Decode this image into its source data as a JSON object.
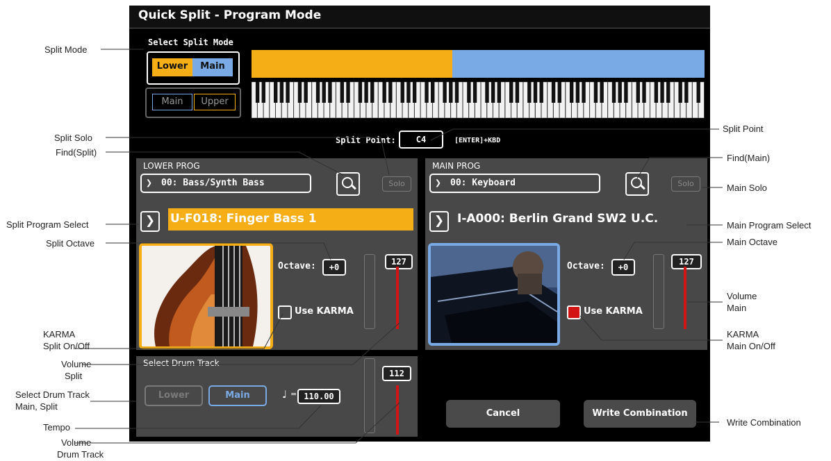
{
  "title": "Quick Split  - Program Mode",
  "split_mode": {
    "heading": "Select Split Mode",
    "option1": {
      "left": "Lower",
      "right": "Main"
    },
    "option2": {
      "left": "Main",
      "right": "Upper"
    }
  },
  "split_point": {
    "label": "Split Point:",
    "value": "C4",
    "hint": "[ENTER]+KBD"
  },
  "lower": {
    "heading": "LOWER PROG",
    "category": "00: Bass/Synth Bass",
    "solo": "Solo",
    "program": "U-F018: Finger Bass 1",
    "octave_label": "Octave:",
    "octave": "+0",
    "karma": "Use KARMA",
    "karma_on": false,
    "volume": "127",
    "volume_level": 1.0
  },
  "main": {
    "heading": "MAIN PROG",
    "category": "00: Keyboard",
    "solo": "Solo",
    "program": "I-A000: Berlin Grand SW2 U.C.",
    "octave_label": "Octave:",
    "octave": "+0",
    "karma": "Use KARMA",
    "karma_on": true,
    "volume": "127",
    "volume_level": 1.0
  },
  "drum": {
    "heading": "Select Drum Track",
    "lower": "Lower",
    "main": "Main",
    "tempo_sep": "=",
    "tempo": "110.00",
    "volume": "112",
    "volume_level": 0.88
  },
  "buttons": {
    "cancel": "Cancel",
    "write": "Write Combination"
  },
  "callouts": {
    "split_mode": "Split Mode",
    "split_solo": "Split Solo",
    "find_split": "Find(Split)",
    "split_program_select": "Split Program Select",
    "split_octave": "Split Octave",
    "karma_split": [
      "KARMA",
      "Split On/Off"
    ],
    "volume_split": [
      "Volume",
      "Split"
    ],
    "select_drum": [
      "Select Drum Track",
      "Main, Split"
    ],
    "tempo": "Tempo",
    "volume_drum": [
      "Volume",
      "Drum Track"
    ],
    "split_point": "Split Point",
    "find_main": "Find(Main)",
    "main_solo": "Main Solo",
    "main_program_select": "Main Program Select",
    "main_octave": "Main Octave",
    "volume_main": [
      "Volume",
      "Main"
    ],
    "karma_main": [
      "KARMA",
      "Main On/Off"
    ],
    "write_combination": "Write Combination"
  },
  "colors": {
    "accent_orange": "#f5ae16",
    "accent_blue": "#7aaae6",
    "volume_red": "#d21414"
  }
}
